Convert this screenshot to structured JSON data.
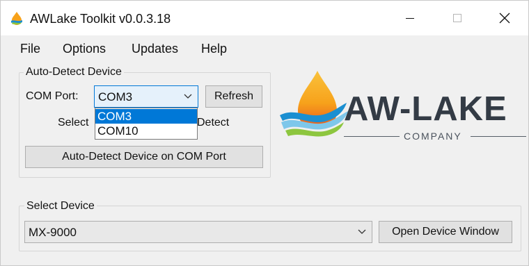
{
  "window": {
    "title": "AWLake Toolkit v0.0.3.18"
  },
  "menu": {
    "items": [
      "File",
      "Options",
      "Updates",
      "Help"
    ]
  },
  "auto_detect": {
    "group_title": "Auto-Detect Device",
    "com_port_label": "COM Port:",
    "com_port_value": "COM3",
    "refresh_label": "Refresh",
    "hint_left": "Select",
    "hint_right": "Detect",
    "dropdown_options": [
      "COM3",
      "COM10"
    ],
    "dropdown_selected": "COM3",
    "auto_detect_button": "Auto-Detect Device on COM Port"
  },
  "logo": {
    "main_text": "AW-LAKE",
    "sub_text": "COMPANY",
    "colors": {
      "drop_top": "#f7a21b",
      "drop_mid": "#e8541d",
      "wave_blue": "#1b8fd1",
      "wave_light": "#7ec7ea",
      "wave_green": "#8dc63f",
      "text": "#333b45"
    }
  },
  "select_device": {
    "group_title": "Select Device",
    "device_value": "MX-9000",
    "open_button": "Open Device Window"
  },
  "accent": "#0078d7"
}
